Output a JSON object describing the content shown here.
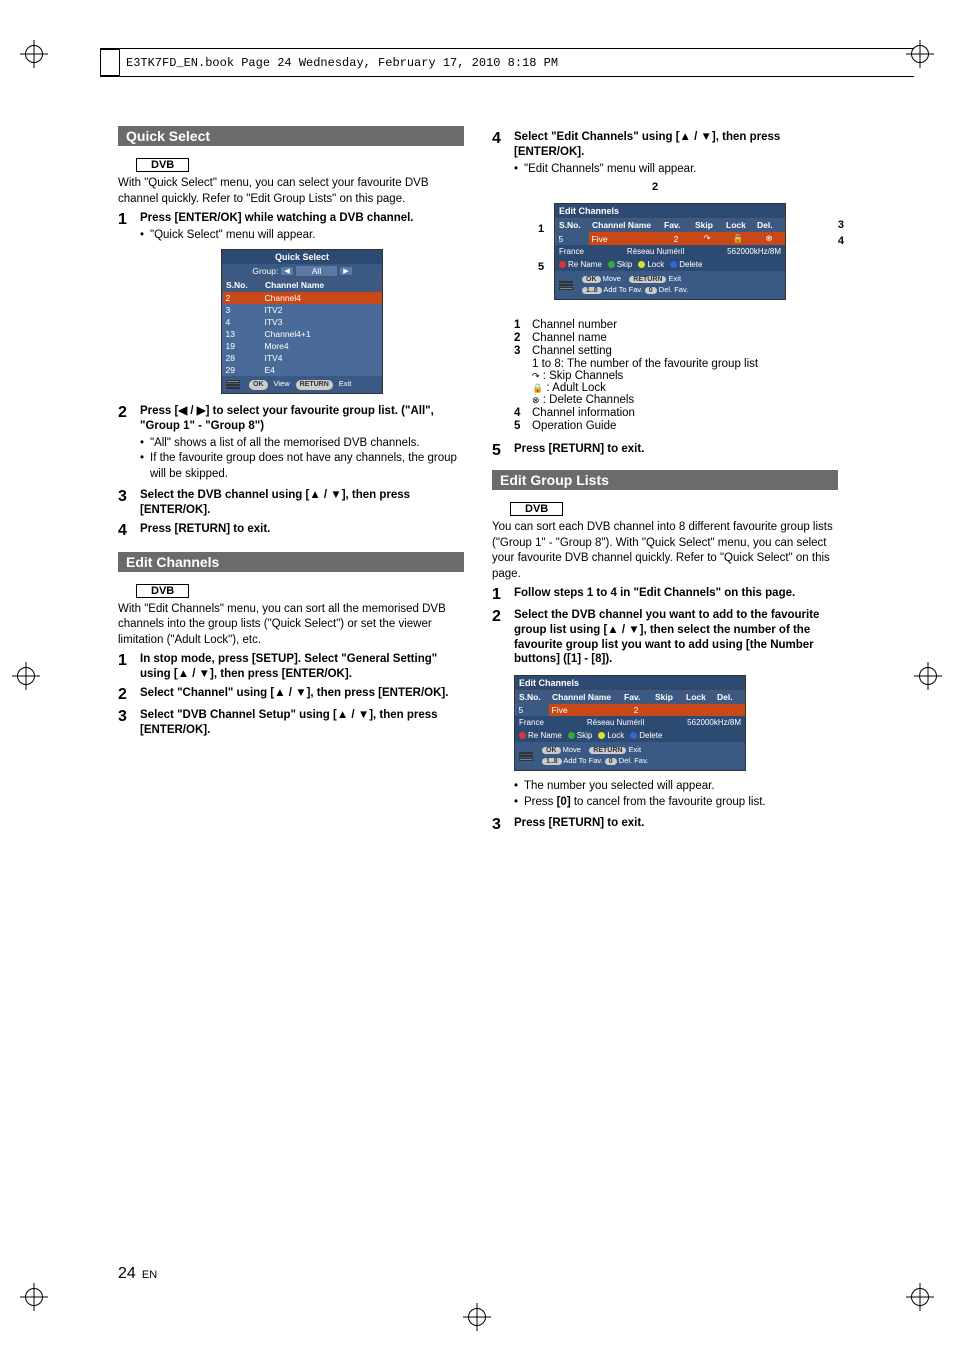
{
  "header": "E3TK7FD_EN.book  Page 24  Wednesday, February 17, 2010  8:18 PM",
  "page_number": "24",
  "page_lang": "EN",
  "left": {
    "section1_title": "Quick Select",
    "section1_tag": "DVB",
    "section1_intro": "With \"Quick Select\" menu, you can select your favourite DVB channel quickly. Refer to \"Edit Group Lists\" on this page.",
    "step1": "Press [ENTER/OK] while watching a DVB channel.",
    "step1_sub": "\"Quick Select\" menu will appear.",
    "step2": "Press [◀ / ▶] to select your favourite group list. (\"All\", \"Group 1\" - \"Group 8\")",
    "step2_sub1": "\"All\" shows a list of all the memorised DVB channels.",
    "step2_sub2": "If the favourite group does not have any channels, the group will be skipped.",
    "step3": "Select the DVB channel using [▲ / ▼], then press [ENTER/OK].",
    "step4": "Press [RETURN] to exit.",
    "section2_title": "Edit Channels",
    "section2_tag": "DVB",
    "section2_intro": "With \"Edit Channels\" menu, you can sort all the memorised DVB channels into the group lists (\"Quick Select\") or set the viewer limitation (\"Adult Lock\"), etc.",
    "s2_step1": "In stop mode, press [SETUP]. Select \"General Setting\" using [▲ / ▼], then press [ENTER/OK].",
    "s2_step2": "Select \"Channel\" using [▲ / ▼], then press [ENTER/OK].",
    "s2_step3": "Select \"DVB Channel Setup\" using [▲ / ▼], then press [ENTER/OK].",
    "osd1": {
      "title": "Quick Select",
      "group_label": "Group:",
      "group_value": "All",
      "hdr_sno": "S.No.",
      "hdr_name": "Channel Name",
      "rows": [
        {
          "s": "2",
          "n": "Channel4"
        },
        {
          "s": "3",
          "n": "ITV2"
        },
        {
          "s": "4",
          "n": "ITV3"
        },
        {
          "s": "13",
          "n": "Channel4+1"
        },
        {
          "s": "19",
          "n": "More4"
        },
        {
          "s": "28",
          "n": "ITV4"
        },
        {
          "s": "29",
          "n": "E4"
        }
      ],
      "guide_ok_view": "View",
      "guide_return_exit": "Exit",
      "pill_ok": "OK",
      "pill_return": "RETURN"
    }
  },
  "right": {
    "step4": "Select \"Edit Channels\" using [▲ / ▼], then press [ENTER/OK].",
    "step4_sub": "\"Edit Channels\" menu will appear.",
    "legend": {
      "l1": "Channel number",
      "l2": "Channel name",
      "l3": "Channel setting",
      "l3a": "1 to 8: The number of the favourite group list",
      "l3b": ": Skip Channels",
      "l3c": ": Adult Lock",
      "l3d": ": Delete Channels",
      "l4": "Channel information",
      "l5": "Operation Guide"
    },
    "step5": "Press [RETURN] to exit.",
    "section3_title": "Edit Group Lists",
    "section3_tag": "DVB",
    "section3_intro": "You can sort each DVB channel into 8 different favourite group lists (\"Group 1\" - \"Group 8\"). With \"Quick Select\" menu, you can select your favourite DVB channel quickly. Refer to \"Quick Select\" on this page.",
    "s3_step1": "Follow steps 1 to 4 in \"Edit Channels\" on this page.",
    "s3_step2": "Select the DVB channel you want to add to the favourite group list using [▲ / ▼], then select the number of the favourite group list you want to add using [the Number buttons] ([1] - [8]).",
    "s3_sub1": "The number you selected will appear.",
    "s3_sub2_a": "Press ",
    "s3_sub2_b": "[0]",
    "s3_sub2_c": " to cancel from the favourite group list.",
    "s3_step3": "Press [RETURN] to exit.",
    "osd2": {
      "title": "Edit Channels",
      "hdr_sno": "S.No.",
      "hdr_name": "Channel Name",
      "hdr_fav": "Fav.",
      "hdr_skip": "Skip",
      "hdr_lock": "Lock",
      "hdr_del": "Del.",
      "row_sno": "5",
      "row_name": "Five",
      "row_fav": "2",
      "info_country": "France",
      "info_net": "Réseau Numéril",
      "info_freq": "562000kHz/8M",
      "btn_rename": "Re Name",
      "btn_skip": "Skip",
      "btn_lock": "Lock",
      "btn_delete": "Delete",
      "guide_move": "Move",
      "guide_exit": "Exit",
      "guide_addfav": "Add To Fav.",
      "guide_delfav": "Del. Fav.",
      "pill_ok": "OK",
      "pill_return": "RETURN",
      "pill_num": "1..8",
      "pill_zero": "0"
    }
  }
}
